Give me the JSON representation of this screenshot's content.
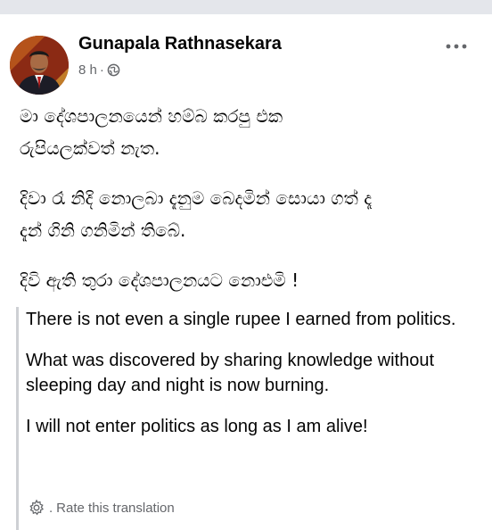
{
  "post": {
    "author": "Gunapala Rathnasekara",
    "time": "8 h",
    "separator": "·",
    "privacy_icon": "globe-icon",
    "more_icon": "ellipsis-icon",
    "original_paragraphs": [
      "මා දේශපාලනයෙන් හම්බ කරපු එක\nරුපියලක්වත් නැත.",
      "දිවා රෑ නිදි නොලබා දැනුම බෙදමින් සොයා ගත් දෑ\nදැන් ගිනි ගනිමින් තිබේ.",
      "දිවි ඇති තුරා දේශපාලනයට නොඑමි !"
    ],
    "translation_paragraphs": [
      "There is not even a single rupee I earned from politics.",
      "What was discovered by sharing knowledge without sleeping day and night is now burning.",
      "I will not enter politics as long as I am alive!"
    ],
    "rate_icon": "gear-icon",
    "rate_bullet": ".",
    "rate_label": "Rate this translation"
  },
  "colors": {
    "text": "#050505",
    "secondary": "#65676b",
    "quote_border": "#ced0d4",
    "top_bar": "#e4e6eb"
  }
}
